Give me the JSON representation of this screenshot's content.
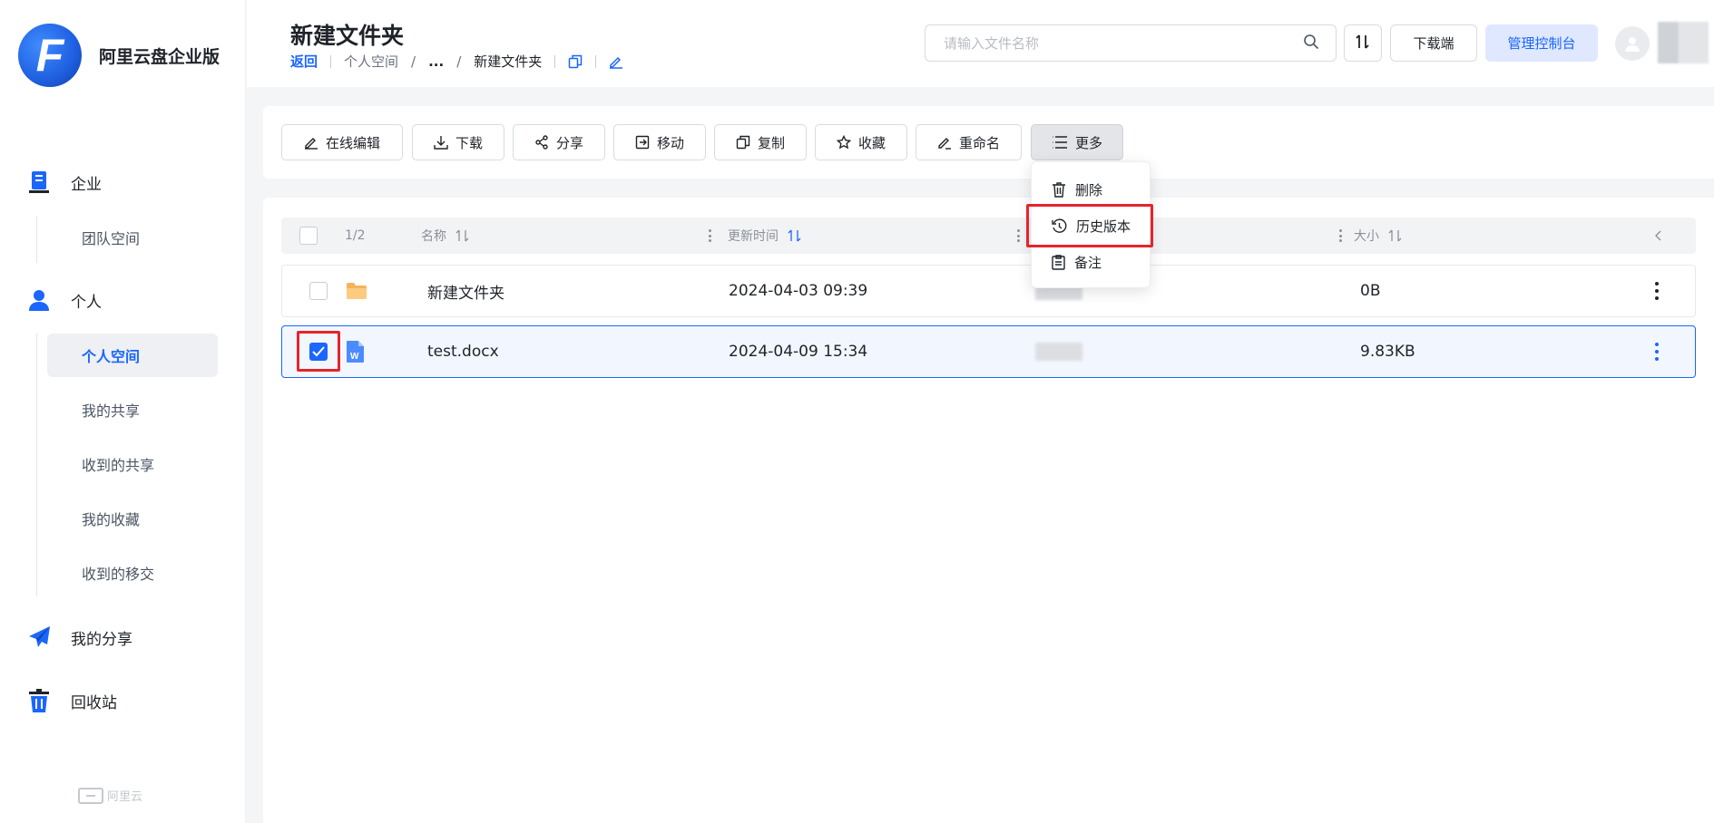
{
  "brand": {
    "name": "阿里云盘企业版",
    "logo_letter": "F"
  },
  "sidebar": {
    "groups": [
      {
        "label": "企业",
        "icon": "building-icon"
      },
      {
        "label": "个人",
        "icon": "user-icon"
      },
      {
        "label": "我的分享",
        "icon": "paper-plane-icon"
      },
      {
        "label": "回收站",
        "icon": "trash-icon"
      }
    ],
    "enterprise_items": [
      "团队空间"
    ],
    "personal_items": [
      "个人空间",
      "我的共享",
      "收到的共享",
      "我的收藏",
      "收到的移交"
    ],
    "active_item": "个人空间",
    "footer": "阿里云"
  },
  "header": {
    "title": "新建文件夹",
    "breadcrumb": {
      "back": "返回",
      "root": "个人空间",
      "ellipsis": "...",
      "current": "新建文件夹"
    },
    "search_placeholder": "请输入文件名称",
    "download_client": "下载端",
    "console": "管理控制台"
  },
  "toolbar": {
    "buttons": [
      {
        "label": "在线编辑",
        "icon": "edit-icon"
      },
      {
        "label": "下载",
        "icon": "download-icon"
      },
      {
        "label": "分享",
        "icon": "share-icon"
      },
      {
        "label": "移动",
        "icon": "move-icon"
      },
      {
        "label": "复制",
        "icon": "copy-icon"
      },
      {
        "label": "收藏",
        "icon": "star-icon"
      },
      {
        "label": "重命名",
        "icon": "rename-icon"
      },
      {
        "label": "更多",
        "icon": "list-icon"
      }
    ]
  },
  "more_menu": {
    "items": [
      {
        "label": "删除",
        "icon": "trash-icon"
      },
      {
        "label": "历史版本",
        "icon": "history-icon"
      },
      {
        "label": "备注",
        "icon": "note-icon"
      }
    ]
  },
  "file_list": {
    "selection_count": "1/2",
    "columns": {
      "name": "名称",
      "updated": "更新时间",
      "size": "大小"
    },
    "rows": [
      {
        "name": "新建文件夹",
        "type": "folder",
        "updated": "2024-04-03 09:39",
        "size": "0B",
        "selected": false
      },
      {
        "name": "test.docx",
        "type": "docx",
        "updated": "2024-04-09 15:34",
        "size": "9.83KB",
        "selected": true
      }
    ]
  },
  "colors": {
    "accent": "#1a66ff",
    "highlight": "#e5242b",
    "folder": "#f6b25a"
  }
}
